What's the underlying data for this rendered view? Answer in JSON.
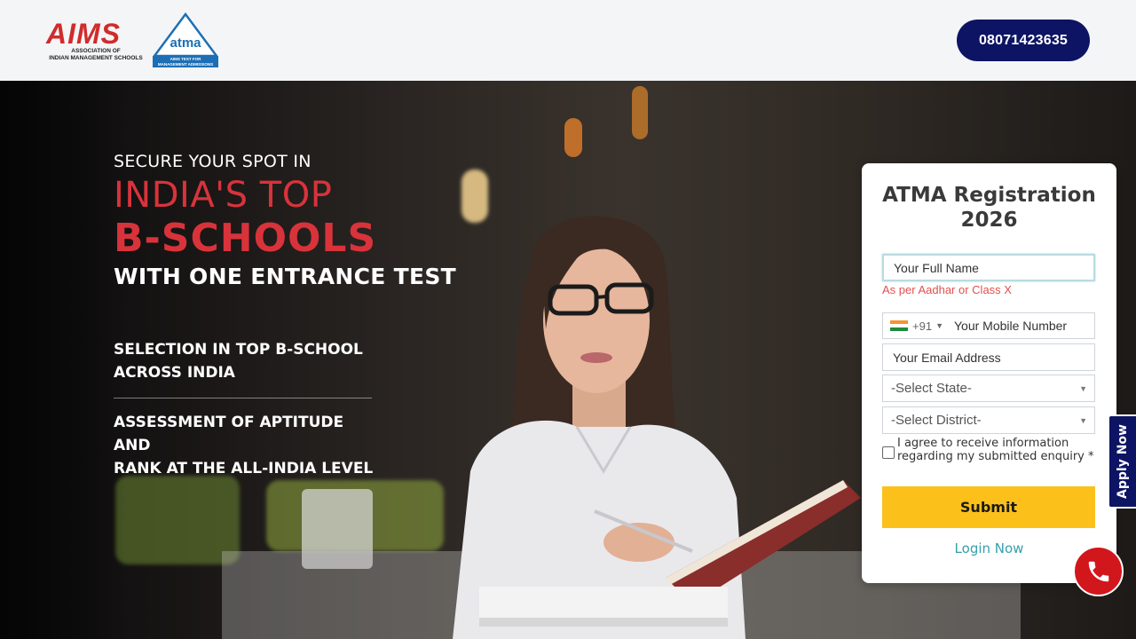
{
  "header": {
    "logo_aims": {
      "word": "AIMS",
      "subtitle_line1": "ASSOCIATION OF",
      "subtitle_line2": "INDIAN MANAGEMENT SCHOOLS"
    },
    "logo_atma": {
      "word": "atma",
      "tag_line1": "AIMS TEST FOR",
      "tag_line2": "MANAGEMENT ADMISSIONS"
    },
    "phone_number": "08071423635"
  },
  "hero": {
    "line1": "SECURE YOUR SPOT IN",
    "line2": "INDIA'S TOP",
    "line3": "B-SCHOOLS",
    "line4": "WITH ONE ENTRANCE TEST",
    "features": [
      {
        "line1": "SELECTION IN TOP B-SCHOOL",
        "line2": "ACROSS INDIA"
      },
      {
        "line1": "ASSESSMENT OF APTITUDE AND",
        "line2": "RANK AT THE ALL-INDIA LEVEL"
      }
    ]
  },
  "form": {
    "title_line1": "ATMA Registration",
    "title_line2": "2026",
    "full_name_placeholder": "Your Full Name",
    "full_name_hint": "As per Aadhar or Class X",
    "country_code": "+91",
    "mobile_placeholder": "Your Mobile Number",
    "email_placeholder": "Your Email Address",
    "state_select": "-Select State-",
    "district_select": "-Select District-",
    "agree_text": "I agree to receive information regarding my submitted enquiry *",
    "submit_label": "Submit",
    "login_label": "Login Now"
  },
  "side": {
    "apply_now_label": "Apply Now"
  },
  "colors": {
    "brand_navy": "#0d1463",
    "brand_red": "#d8333b",
    "submit_yellow": "#fbc01a",
    "link_teal": "#35a0ad",
    "call_red": "#d1161c"
  },
  "icons": {
    "flag": "india-flag-icon",
    "caret": "chevron-down-icon",
    "call": "phone-icon"
  }
}
